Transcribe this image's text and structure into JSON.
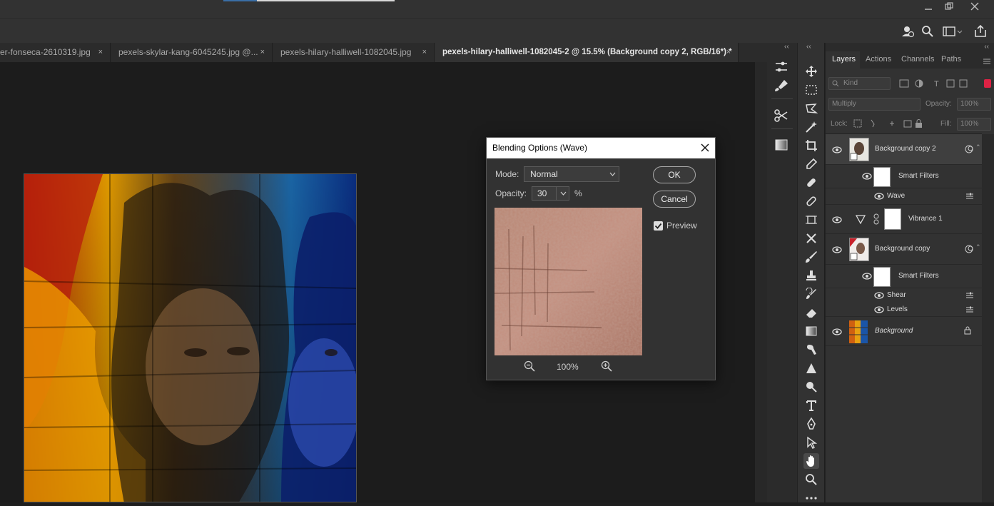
{
  "window": {
    "minimize_icon": "minimize-icon",
    "restore_icon": "restore-icon",
    "close_icon": "close-icon"
  },
  "tabs": [
    {
      "label": "er-fonseca-2610319.jpg",
      "close": "×"
    },
    {
      "label": "pexels-skylar-kang-6045245.jpg @...",
      "close": "×"
    },
    {
      "label": "pexels-hilary-halliwell-1082045.jpg",
      "close": "×"
    },
    {
      "label": "pexels-hilary-halliwell-1082045-2 @ 15.5% (Background copy 2, RGB/16*) *",
      "close": "×"
    }
  ],
  "collapse_glyph": "‹‹",
  "panels": {
    "tabs": [
      "Layers",
      "Actions",
      "Channels",
      "Paths"
    ],
    "kind_placeholder": "Kind",
    "blend_mode": "Multiply",
    "opacity_label": "Opacity:",
    "opacity_value": "100%",
    "lock_label": "Lock:",
    "fill_label": "Fill:",
    "fill_value": "100%",
    "layers": {
      "bg_copy2": "Background copy 2",
      "smart_filters_1": "Smart Filters",
      "wave": "Wave",
      "vibrance": "Vibrance 1",
      "bg_copy": "Background copy",
      "smart_filters_2": "Smart Filters",
      "shear": "Shear",
      "levels": "Levels",
      "background": "Background"
    }
  },
  "dialog": {
    "title": "Blending Options (Wave)",
    "mode_label": "Mode:",
    "mode_value": "Normal",
    "opacity_label": "Opacity:",
    "opacity_value": "30",
    "percent": "%",
    "ok_label": "OK",
    "cancel_label": "Cancel",
    "preview_label": "Preview",
    "preview_checked": true,
    "zoom_value": "100%"
  },
  "colors": {
    "accent": "#3a6ea5",
    "panel_bg": "#323232",
    "canvas_bg": "#1c1c1c"
  }
}
